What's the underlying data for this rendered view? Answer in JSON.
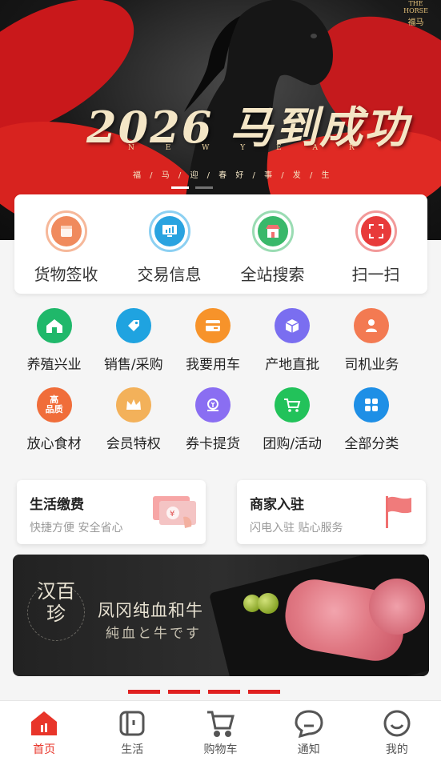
{
  "banner": {
    "brand_en_top": "THE",
    "brand_en": "HORSE",
    "brand_cn": "福马",
    "title": "2026 马到成功",
    "sub_en": "N E W Y E A R",
    "sub_cn": "福 / 马 / 迎 / 春   好 / 事 / 发 / 生",
    "slides": 2,
    "active_slide": 0
  },
  "quick_actions": [
    {
      "label": "货物签收",
      "icon": "package-icon",
      "color": "#f08a5d"
    },
    {
      "label": "交易信息",
      "icon": "monitor-icon",
      "color": "#29a3e0"
    },
    {
      "label": "全站搜索",
      "icon": "store-icon",
      "color": "#39b86a"
    },
    {
      "label": "扫一扫",
      "icon": "scan-icon",
      "color": "#e83a3a"
    }
  ],
  "categories": [
    {
      "label": "养殖兴业",
      "icon": "farm-icon",
      "color": "#1fb86a"
    },
    {
      "label": "销售/采购",
      "icon": "tag-icon",
      "color": "#1fa3e0"
    },
    {
      "label": "我要用车",
      "icon": "car-card-icon",
      "color": "#f7932a"
    },
    {
      "label": "产地直批",
      "icon": "box-icon",
      "color": "#7a6ef0"
    },
    {
      "label": "司机业务",
      "icon": "driver-icon",
      "color": "#f37a52"
    },
    {
      "label": "放心食材",
      "icon": "quality-badge-icon",
      "color": "#f06d3a",
      "text": "高品质"
    },
    {
      "label": "会员特权",
      "icon": "crown-icon",
      "color": "#f3b15a"
    },
    {
      "label": "券卡提货",
      "icon": "coupon-icon",
      "color": "#8a6ef2"
    },
    {
      "label": "团购/活动",
      "icon": "cart-icon",
      "color": "#22c25a"
    },
    {
      "label": "全部分类",
      "icon": "grid-icon",
      "color": "#1e8fe6"
    }
  ],
  "promos": [
    {
      "title": "生活缴费",
      "subtitle": "快捷方便 安全省心",
      "icon": "bill-card-icon"
    },
    {
      "title": "商家入驻",
      "subtitle": "闪电入驻 贴心服务",
      "icon": "flag-icon"
    }
  ],
  "ad": {
    "logo": "汉百珍",
    "tagline": "凤冈纯血和牛",
    "tagline_jp": "純血と牛です"
  },
  "tabs": [
    {
      "label": "首页",
      "icon": "home-icon",
      "active": true
    },
    {
      "label": "生活",
      "icon": "life-icon",
      "active": false
    },
    {
      "label": "购物车",
      "icon": "shopping-cart-icon",
      "active": false
    },
    {
      "label": "通知",
      "icon": "chat-bubble-icon",
      "active": false
    },
    {
      "label": "我的",
      "icon": "smile-icon",
      "active": false
    }
  ],
  "colors": {
    "accent": "#e8352a",
    "banner_red": "#d8231f"
  }
}
